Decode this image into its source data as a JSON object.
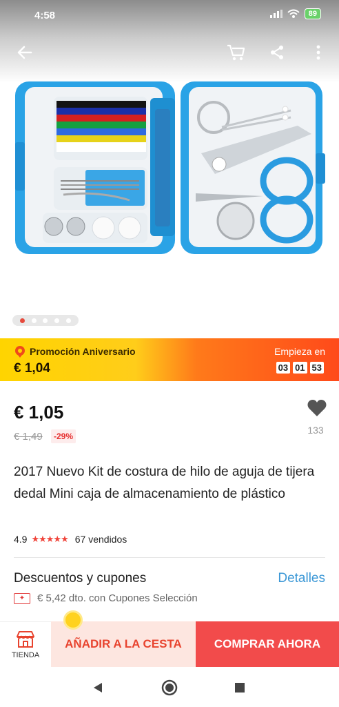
{
  "status_bar": {
    "time": "4:58",
    "battery": "89"
  },
  "gallery": {
    "image_count": 5,
    "active_index": 0
  },
  "promo": {
    "title": "Promoción Aniversario",
    "price": "€ 1,04",
    "starts_label": "Empieza en",
    "countdown": [
      "03",
      "01",
      "53"
    ]
  },
  "product": {
    "price": "€ 1,05",
    "old_price": "€ 1,49",
    "discount": "-29%",
    "wishlist_count": "133",
    "title": "2017 Nuevo Kit de costura de hilo de aguja de tijera dedal Mini caja de almacenamiento de plástico",
    "rating": "4.9",
    "stars": 5,
    "sold": "67 vendidos"
  },
  "coupons": {
    "title": "Descuentos y cupones",
    "details_label": "Detalles",
    "coupon_text": "€ 5,42 dto. con Cupones Selección"
  },
  "actions": {
    "store_label": "TIENDA",
    "add_to_cart": "AÑADIR A LA CESTA",
    "buy_now": "COMPRAR AHORA"
  },
  "colors": {
    "accent_red": "#f24b4b",
    "link_blue": "#3a97d6",
    "promo_yellow": "#ffd400",
    "promo_orange": "#ff4a1a",
    "kit_blue": "#2aa3e6"
  }
}
